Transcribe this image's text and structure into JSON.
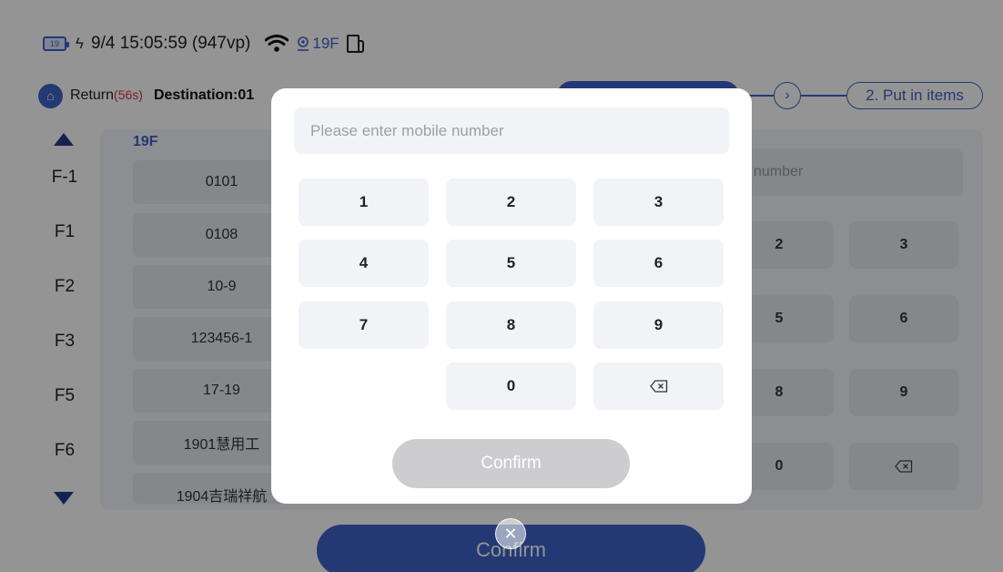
{
  "status": {
    "battery": "19",
    "datetime": "9/4 15:05:59 (947vp)",
    "location": "19F"
  },
  "header": {
    "return_label": "Return",
    "return_countdown": "(56s)",
    "destination": "Destination:01",
    "step2": "2. Put in items"
  },
  "floors": [
    "F-1",
    "F1",
    "F2",
    "F3",
    "F5",
    "F6"
  ],
  "current_floor": "19F",
  "rooms": [
    "0101",
    "0108",
    "10-9",
    "123456-1",
    "17-19",
    "1901慧用工",
    "1904吉瑞祥航"
  ],
  "background_form": {
    "field_placeholder": "number",
    "keys": [
      "2",
      "3",
      "5",
      "6",
      "8",
      "9",
      "0"
    ],
    "confirm_label": "Confirm"
  },
  "modal": {
    "placeholder": "Please enter mobile number",
    "keys": [
      "1",
      "2",
      "3",
      "4",
      "5",
      "6",
      "7",
      "8",
      "9",
      "0"
    ],
    "confirm_label": "Confirm",
    "backspace_icon": "backspace-icon",
    "close_icon": "close-icon"
  },
  "colors": {
    "accent": "#3f63c8",
    "countdown": "#d9364a",
    "floor_arrow": "#233e8a"
  }
}
